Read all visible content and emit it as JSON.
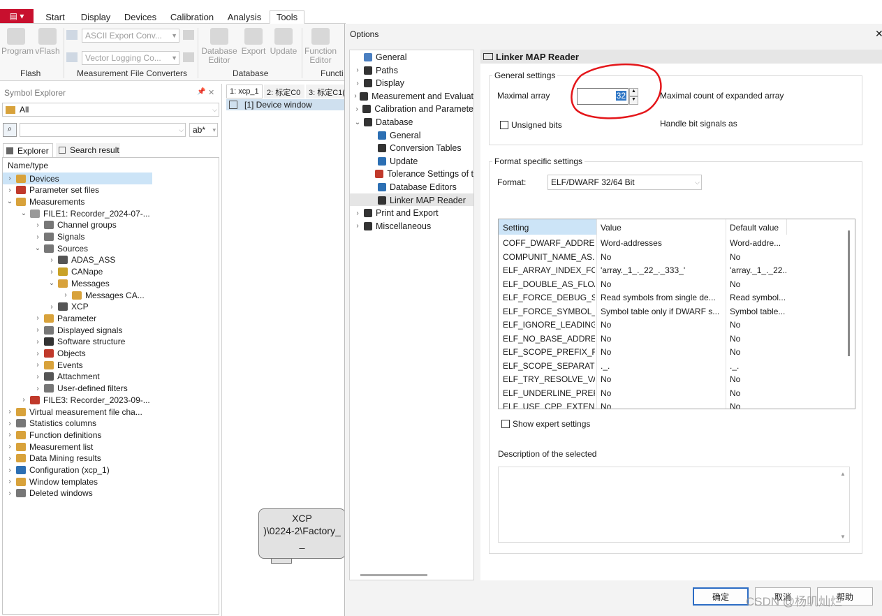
{
  "ribbon": {
    "app_menu_label": "▤ ▾",
    "tabs": [
      "Start",
      "Display",
      "Devices",
      "Calibration",
      "Analysis",
      "Tools"
    ],
    "flash": {
      "program": "Program",
      "vflash": "vFlash",
      "label": "Flash"
    },
    "converters": {
      "combo1": "ASCII Export Conv...",
      "combo2": "Vector Logging Co...",
      "label": "Measurement File Converters"
    },
    "database": {
      "editor": "Database Editor",
      "export": "Export",
      "update": "Update",
      "label": "Database"
    },
    "function": {
      "editor": "Function Editor",
      "label": "Functi"
    }
  },
  "symbol_explorer": {
    "title": "Symbol Explorer",
    "pin": "📌",
    "close": "✕",
    "filter_value": "All",
    "search_value": "",
    "search_mode": "ab*",
    "tab_explorer": "Explorer",
    "tab_search": "Search result",
    "header": "Name/type",
    "tree": [
      {
        "label": "Devices",
        "color": "#d8a23b"
      },
      {
        "label": "Parameter set files",
        "color": "#c0392b"
      },
      {
        "label": "Measurements",
        "color": "#d8a23b"
      },
      {
        "label": "FILE1: Recorder_2024-07-...",
        "color": "#999"
      },
      {
        "label": "Channel groups",
        "color": "#777"
      },
      {
        "label": "Signals",
        "color": "#777"
      },
      {
        "label": "Sources",
        "color": "#777"
      },
      {
        "label": "ADAS_ASS",
        "color": "#555"
      },
      {
        "label": "CANape",
        "color": "#c9a227"
      },
      {
        "label": "Messages",
        "color": "#d8a23b"
      },
      {
        "label": "Messages CA...",
        "color": "#d8a23b"
      },
      {
        "label": "XCP",
        "color": "#555"
      },
      {
        "label": "Parameter",
        "color": "#d8a23b"
      },
      {
        "label": "Displayed signals",
        "color": "#777"
      },
      {
        "label": "Software structure",
        "color": "#333"
      },
      {
        "label": "Objects",
        "color": "#c0392b"
      },
      {
        "label": "Events",
        "color": "#d8a23b"
      },
      {
        "label": "Attachment",
        "color": "#555"
      },
      {
        "label": "User-defined filters",
        "color": "#777"
      },
      {
        "label": "FILE3: Recorder_2023-09-...",
        "color": "#c0392b"
      },
      {
        "label": "Virtual measurement file cha...",
        "color": "#d8a23b"
      },
      {
        "label": "Statistics columns",
        "color": "#777"
      },
      {
        "label": "Function definitions",
        "color": "#d8a23b"
      },
      {
        "label": "Measurement list",
        "color": "#d8a23b"
      },
      {
        "label": "Data Mining results",
        "color": "#d8a23b"
      },
      {
        "label": "Configuration (xcp_1)",
        "color": "#2c6fb3"
      },
      {
        "label": "Window templates",
        "color": "#d8a23b"
      },
      {
        "label": "Deleted windows",
        "color": "#777"
      }
    ]
  },
  "center": {
    "tabs": [
      "1: xcp_1",
      "2: 标定C0",
      "3: 标定C1("
    ],
    "device_window": "[1] Device window",
    "node_title": "XCP",
    "node_line2": ")\\0224-2\\Factory_",
    "node_line3": "_"
  },
  "dialog": {
    "title": "Options",
    "close": "✕",
    "nav": [
      {
        "label": "General"
      },
      {
        "label": "Paths"
      },
      {
        "label": "Display"
      },
      {
        "label": "Measurement and Evaluat"
      },
      {
        "label": "Calibration and Paramete"
      },
      {
        "label": "Database"
      },
      {
        "label": "General"
      },
      {
        "label": "Conversion Tables"
      },
      {
        "label": "Update"
      },
      {
        "label": "Tolerance Settings of t"
      },
      {
        "label": "Database Editors"
      },
      {
        "label": "Linker MAP Reader"
      },
      {
        "label": "Print and Export"
      },
      {
        "label": "Miscellaneous"
      }
    ],
    "page_title": "Linker MAP Reader",
    "general_settings": {
      "label": "General settings",
      "maximal_array": "Maximal array",
      "maximal_array_value": "32",
      "maximal_array_desc": "Maximal count of expanded array",
      "unsigned_bits": "Unsigned bits",
      "handle_bits": "Handle bit signals as"
    },
    "format_settings": {
      "label": "Format specific settings",
      "format_label": "Format:",
      "format_value": "ELF/DWARF 32/64 Bit"
    },
    "grid": {
      "columns": [
        "Setting",
        "Value",
        "Default value"
      ],
      "rows": [
        [
          "COFF_DWARF_ADDRES...",
          "Word-addresses",
          "Word-addre..."
        ],
        [
          "COMPUNIT_NAME_AS...",
          "No",
          "No"
        ],
        [
          "ELF_ARRAY_INDEX_FO...",
          "'array._1_._22_._333_'",
          "'array._1_._22..."
        ],
        [
          "ELF_DOUBLE_AS_FLOAT",
          "No",
          "No"
        ],
        [
          "ELF_FORCE_DEBUG_SE...",
          "Read symbols from single de...",
          "Read symbol..."
        ],
        [
          "ELF_FORCE_SYMBOL_T...",
          "Symbol table only if DWARF s...",
          "Symbol table..."
        ],
        [
          "ELF_IGNORE_LEADING...",
          "No",
          "No"
        ],
        [
          "ELF_NO_BASE_ADDRE...",
          "No",
          "No"
        ],
        [
          "ELF_SCOPE_PREFIX_FO...",
          "No",
          "No"
        ],
        [
          "ELF_SCOPE_SEPARATOR",
          "._.",
          "._."
        ],
        [
          "ELF_TRY_RESOLVE_VA...",
          "No",
          "No"
        ],
        [
          "ELF_UNDERLINE_PREFIX",
          "No",
          "No"
        ],
        [
          "ELF_USE_CPP_EXTENSI...",
          "No",
          "No"
        ]
      ]
    },
    "show_expert": "Show expert settings",
    "description_label": "Description of the selected",
    "ok": "确定",
    "cancel": "取消",
    "help": "帮助",
    "watermark": "CSDN @杨叽灿烂"
  }
}
